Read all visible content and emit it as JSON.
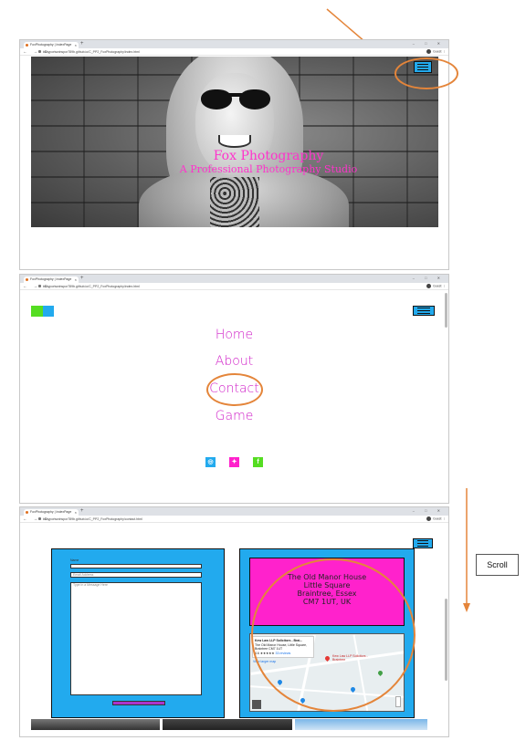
{
  "browser": {
    "tab_title": "FoxPhotography | IndexPage",
    "tab_close": "×",
    "new_tab": "+",
    "window_controls": "– □ ✕",
    "nav_buttons": "← → C",
    "url": "kanyportswinspor789b.github.io/C_PP2_FoxPhotography/index.html",
    "url_contact": "kanyportswinspor789b.github.io/C_PP2_FoxPhotography/contact.html",
    "profile_label": "Guest",
    "menu_dots": "⋮"
  },
  "hero": {
    "title": "Fox Photography",
    "subtitle": "A Professional Photography Studio"
  },
  "menu": {
    "items": [
      {
        "label": "Home"
      },
      {
        "label": "About"
      },
      {
        "label": "Contact"
      },
      {
        "label": "Game"
      }
    ],
    "social": [
      {
        "icon": "instagram-icon",
        "glyph": "◎",
        "color": "#22aaee"
      },
      {
        "icon": "twitter-icon",
        "glyph": "✦",
        "color": "#ff22cc"
      },
      {
        "icon": "facebook-icon",
        "glyph": "f",
        "color": "#55dd22"
      }
    ],
    "logo_colors": [
      "#55dd22",
      "#22aaee"
    ]
  },
  "contact": {
    "form": {
      "name_label": "Name",
      "email_label": "Email Address",
      "message_placeholder": "Type in a Message Here"
    },
    "address": {
      "line1": "The Old Manor House",
      "line2": "Little Square",
      "line3": "Braintree, Essex",
      "line4": "CM7 1UT, UK"
    },
    "map": {
      "place_title": "Kew Law LLP Solicitors - Brai...",
      "place_address": "The Old Manor House, Little Square, Braintree CM7 1UT",
      "rating": "4.6 ★★★★★",
      "reviews": "33 reviews",
      "view_larger": "View larger map",
      "pin_label": "Kew Law LLP Solicitors - Braintree",
      "directions": "Directions"
    }
  },
  "annotations": {
    "scroll_label": "Scroll"
  },
  "colors": {
    "accent_blue": "#22aaee",
    "accent_pink": "#ff22cc",
    "accent_green": "#55dd22",
    "menu_text": "#d020c8",
    "annotation_orange": "#e4853a"
  }
}
